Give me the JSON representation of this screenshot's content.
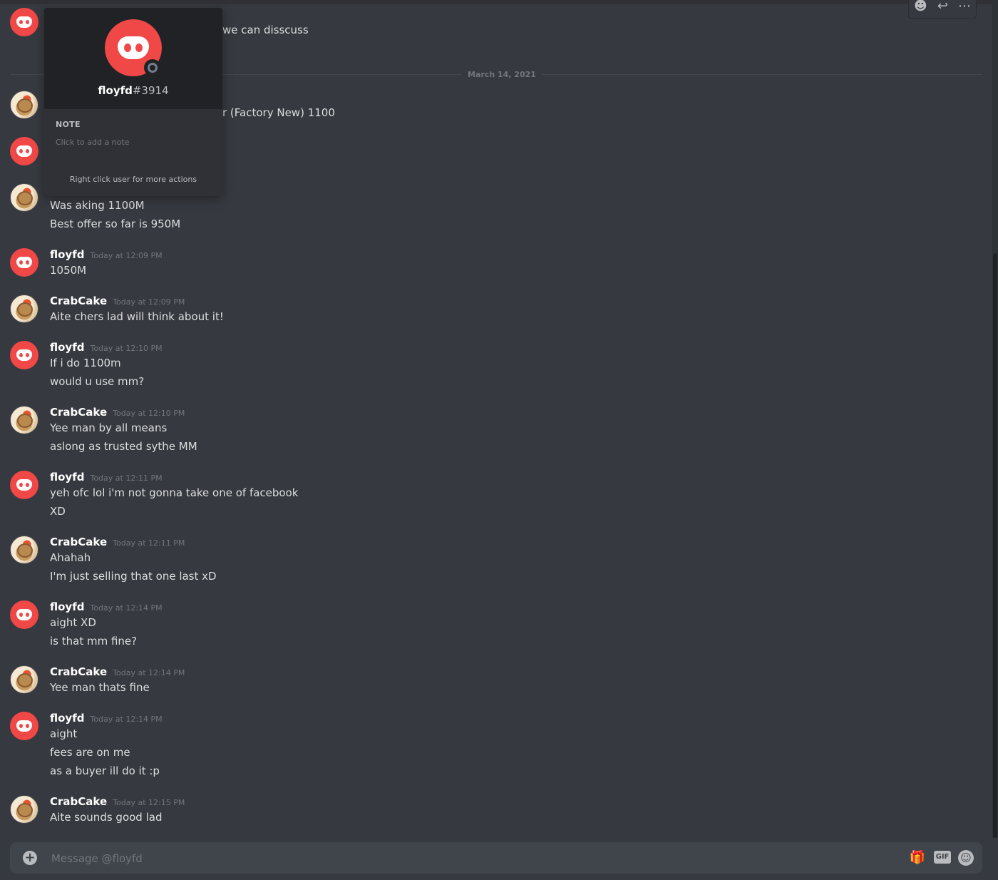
{
  "hover_actions": {
    "add_reaction": "☻",
    "reply": "↩",
    "more": "⋯"
  },
  "partial_messages": {
    "top_text": "we can disscuss",
    "item_text": "r (Factory New)  1100"
  },
  "date_divider": "March 14, 2021",
  "messages": [
    {
      "author": "",
      "time": "",
      "lines": [
        "Was aking 1100M",
        "Best offer so far is 950M"
      ]
    },
    {
      "author": "floyfd",
      "time": "Today at 12:09 PM",
      "lines": [
        "1050M"
      ]
    },
    {
      "author": "CrabCake",
      "time": "Today at 12:09 PM",
      "lines": [
        "Aite chers lad will think about it!"
      ]
    },
    {
      "author": "floyfd",
      "time": "Today at 12:10 PM",
      "lines": [
        "If i do 1100m",
        "would u use mm?"
      ]
    },
    {
      "author": "CrabCake",
      "time": "Today at 12:10 PM",
      "lines": [
        "Yee man by all means",
        "aslong as trusted sythe MM"
      ]
    },
    {
      "author": "floyfd",
      "time": "Today at 12:11 PM",
      "lines": [
        "yeh ofc lol i'm not gonna take one of facebook",
        "XD"
      ]
    },
    {
      "author": "CrabCake",
      "time": "Today at 12:11 PM",
      "lines": [
        "Ahahah",
        "I'm just selling that one last xD"
      ]
    },
    {
      "author": "floyfd",
      "time": "Today at 12:14 PM",
      "lines": [
        "aight XD",
        "is that mm fine?"
      ]
    },
    {
      "author": "CrabCake",
      "time": "Today at 12:14 PM",
      "lines": [
        "Yee man thats fine"
      ]
    },
    {
      "author": "floyfd",
      "time": "Today at 12:14 PM",
      "lines": [
        "aight",
        "fees are on me",
        "as a buyer ill do it :p"
      ]
    },
    {
      "author": "CrabCake",
      "time": "Today at 12:15 PM",
      "lines": [
        "Aite sounds good lad"
      ]
    }
  ],
  "popout": {
    "username": "floyfd",
    "discriminator": "#3914",
    "note_title": "NOTE",
    "note_placeholder": "Click to add a note",
    "footer": "Right click user for more actions"
  },
  "composer": {
    "placeholder": "Message @floyfd",
    "plus": "+",
    "gift_icon": "🎁",
    "gif_label": "GIF",
    "emoji": "☺"
  },
  "colors": {
    "background": "#36393f",
    "brand_red": "#f04747",
    "popout_bg": "#2f3136"
  }
}
